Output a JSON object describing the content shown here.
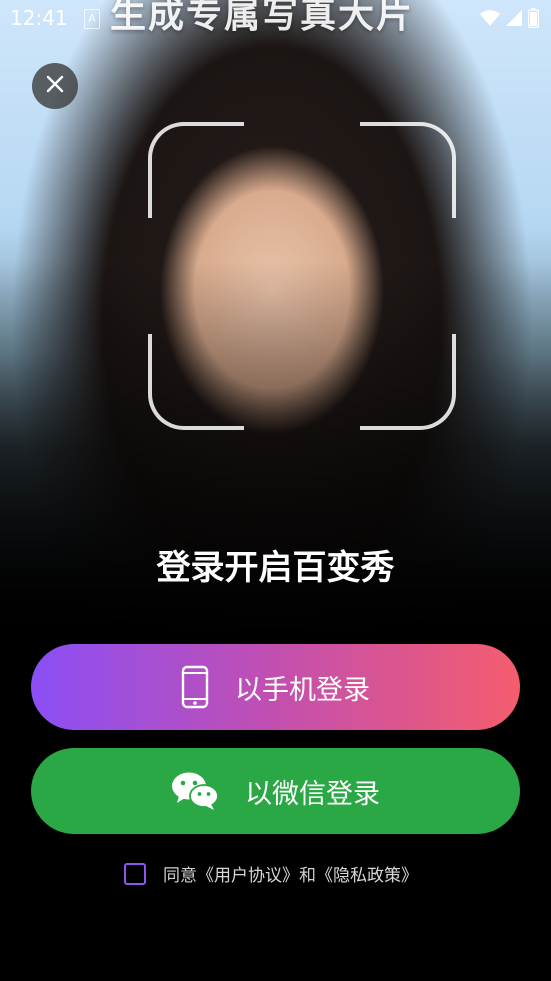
{
  "status_bar": {
    "time": "12:41",
    "notification_icon": "A"
  },
  "banner": {
    "title": "生成专属写真大片"
  },
  "login": {
    "headline": "登录开启百变秀",
    "phone_button_label": "以手机登录",
    "wechat_button_label": "以微信登录"
  },
  "agreement": {
    "prefix": "同意",
    "user_agreement": "《用户协议》",
    "conjunction": "和",
    "privacy_policy": "《隐私政策》"
  },
  "icons": {
    "close": "close-icon",
    "phone": "smartphone-icon",
    "wechat": "wechat-icon",
    "wifi": "wifi-icon",
    "signal": "signal-icon",
    "battery": "battery-icon"
  },
  "colors": {
    "phone_gradient_start": "#8b4ff5",
    "phone_gradient_end": "#f45d6d",
    "wechat_green": "#2aa845",
    "checkbox_border": "#8a55f2"
  }
}
